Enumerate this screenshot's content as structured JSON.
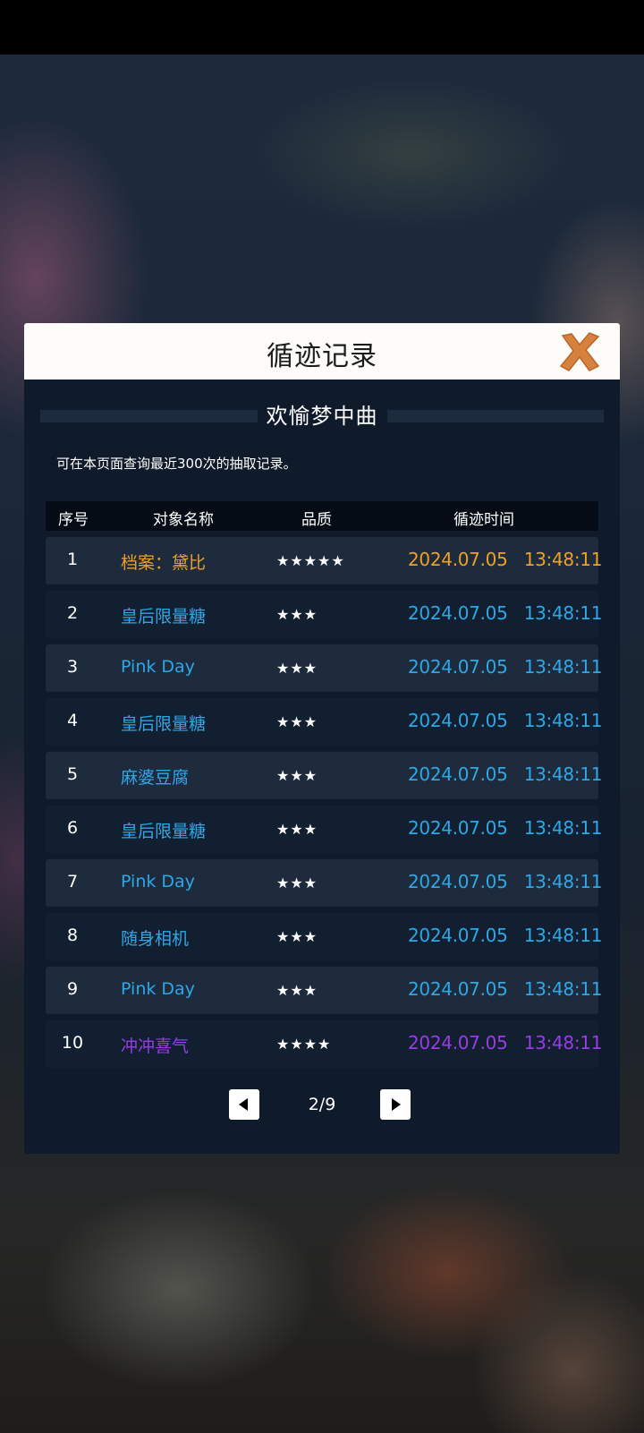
{
  "dialog": {
    "title": "循迹记录",
    "subtitle": "欢愉梦中曲",
    "info": "可在本页面查询最近300次的抽取记录。"
  },
  "table": {
    "headers": [
      "序号",
      "对象名称",
      "品质",
      "循迹时间"
    ],
    "rows": [
      {
        "index": "1",
        "name": "档案：黛比",
        "stars": "★★★★★",
        "date": "2024.07.05",
        "time": "13:48:11",
        "color": "#f0a021"
      },
      {
        "index": "2",
        "name": "皇后限量糖",
        "stars": "★★★",
        "date": "2024.07.05",
        "time": "13:48:11",
        "color": "#2ea7e8"
      },
      {
        "index": "3",
        "name": "Pink Day",
        "stars": "★★★",
        "date": "2024.07.05",
        "time": "13:48:11",
        "color": "#2ea7e8"
      },
      {
        "index": "4",
        "name": "皇后限量糖",
        "stars": "★★★",
        "date": "2024.07.05",
        "time": "13:48:11",
        "color": "#2ea7e8"
      },
      {
        "index": "5",
        "name": "麻婆豆腐",
        "stars": "★★★",
        "date": "2024.07.05",
        "time": "13:48:11",
        "color": "#2ea7e8"
      },
      {
        "index": "6",
        "name": "皇后限量糖",
        "stars": "★★★",
        "date": "2024.07.05",
        "time": "13:48:11",
        "color": "#2ea7e8"
      },
      {
        "index": "7",
        "name": "Pink Day",
        "stars": "★★★",
        "date": "2024.07.05",
        "time": "13:48:11",
        "color": "#2ea7e8"
      },
      {
        "index": "8",
        "name": "随身相机",
        "stars": "★★★",
        "date": "2024.07.05",
        "time": "13:48:11",
        "color": "#2ea7e8"
      },
      {
        "index": "9",
        "name": "Pink Day",
        "stars": "★★★",
        "date": "2024.07.05",
        "time": "13:48:11",
        "color": "#2ea7e8"
      },
      {
        "index": "10",
        "name": "冲冲喜气",
        "stars": "★★★★",
        "date": "2024.07.05",
        "time": "13:48:11",
        "color": "#9b3be8"
      }
    ]
  },
  "pager": {
    "page_text": "2/9",
    "prev_icon": "triangle-left-icon",
    "next_icon": "triangle-right-icon"
  },
  "icons": {
    "close": "close-icon"
  },
  "colors": {
    "orange_5star": "#f0a021",
    "blue_3star": "#2ea7e8",
    "purple_4star": "#9b3be8",
    "close_icon": "#d6813e"
  }
}
